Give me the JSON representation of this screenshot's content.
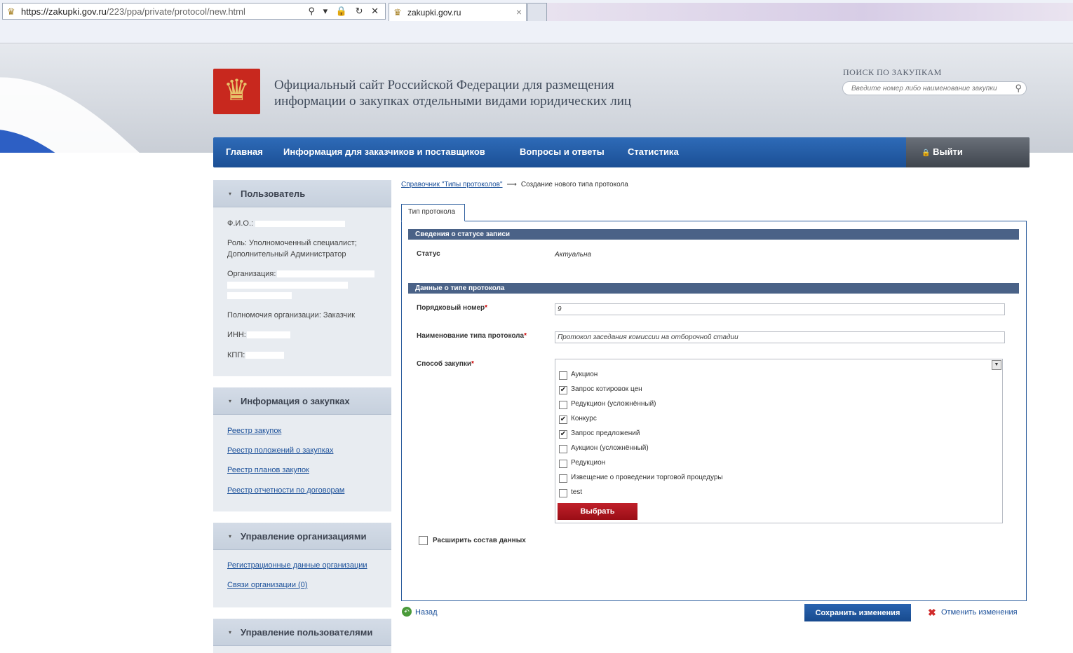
{
  "browser": {
    "url_host": "https://zakupki.gov.ru",
    "url_path": "/223/ppa/private/protocol/new.html",
    "tab_title": "zakupki.gov.ru",
    "address_tools": "⚲ ▾ 🔒 ↻ ✕",
    "tab_close": "×"
  },
  "header": {
    "title_line1": "Официальный сайт Российской Федерации для размещения",
    "title_line2": "информации о закупках отдельными видами юридических лиц",
    "search_label": "ПОИСК ПО ЗАКУПКАМ",
    "search_placeholder": "Введите номер либо наименование закупки",
    "emblem_glyph": "♛"
  },
  "nav": {
    "items": [
      "Главная",
      "Информация для заказчиков и поставщиков",
      "Вопросы и ответы",
      "Статистика"
    ],
    "logout": "Выйти",
    "logout_icon": "🔒"
  },
  "sidebar": {
    "user": {
      "heading": "Пользователь",
      "fio_label": "Ф.И.О.:",
      "role_line1": "Роль: Уполномоченный специалист;",
      "role_line2": "Дополнительный Администратор",
      "org_label": "Организация:",
      "powers": "Полномочия организации: Заказчик",
      "inn_label": "ИНН:",
      "kpp_label": "КПП:"
    },
    "procurement": {
      "heading": "Информация о закупках",
      "links": [
        "Реестр закупок",
        "Реестр положений о закупках",
        "Реестр планов закупок",
        "Реестр отчетности по договорам"
      ]
    },
    "orgs": {
      "heading": "Управление организациями",
      "links": [
        "Регистрационные данные организации",
        "Связи организации (0)"
      ]
    },
    "users": {
      "heading": "Управление пользователями"
    },
    "collapse_icon": "▾"
  },
  "breadcrumb": {
    "link": "Справочник \"Типы протоколов\"",
    "arrow": "⟶",
    "current": "Создание нового типа протокола"
  },
  "form": {
    "tab": "Тип протокола",
    "section_status": "Сведения о статусе записи",
    "status_label": "Статус",
    "status_value": "Актуальна",
    "section_type": "Данные о типе протокола",
    "order_label": "Порядковый номер",
    "order_value": "9",
    "name_label": "Наименование типа протокола",
    "name_value": "Протокол заседания комиссии на отборочной стадии",
    "method_label": "Способ закупки",
    "required_mark": "*",
    "options": [
      {
        "label": "Аукцион",
        "checked": false
      },
      {
        "label": "Запрос котировок цен",
        "checked": true
      },
      {
        "label": "Редукцион (усложнённый)",
        "checked": false
      },
      {
        "label": "Конкурс",
        "checked": true
      },
      {
        "label": "Запрос предложений",
        "checked": true
      },
      {
        "label": "Аукцион (усложнённый)",
        "checked": false
      },
      {
        "label": "Редукцион",
        "checked": false
      },
      {
        "label": "Извещение о проведении торговой процедуры",
        "checked": false
      },
      {
        "label": "test",
        "checked": false
      }
    ],
    "select_button": "Выбрать",
    "extend_label": "Расширить состав данных",
    "extend_checked": false
  },
  "actions": {
    "back": "Назад",
    "save": "Сохранить изменения",
    "cancel": "Отменить изменения",
    "check_mark": "✔",
    "cancel_icon": "✖",
    "back_icon": "↶"
  },
  "colors": {
    "nav_blue": "#1b4f95",
    "section_header": "#4a6287",
    "select_button": "#b0151f",
    "link": "#1a4f99"
  }
}
